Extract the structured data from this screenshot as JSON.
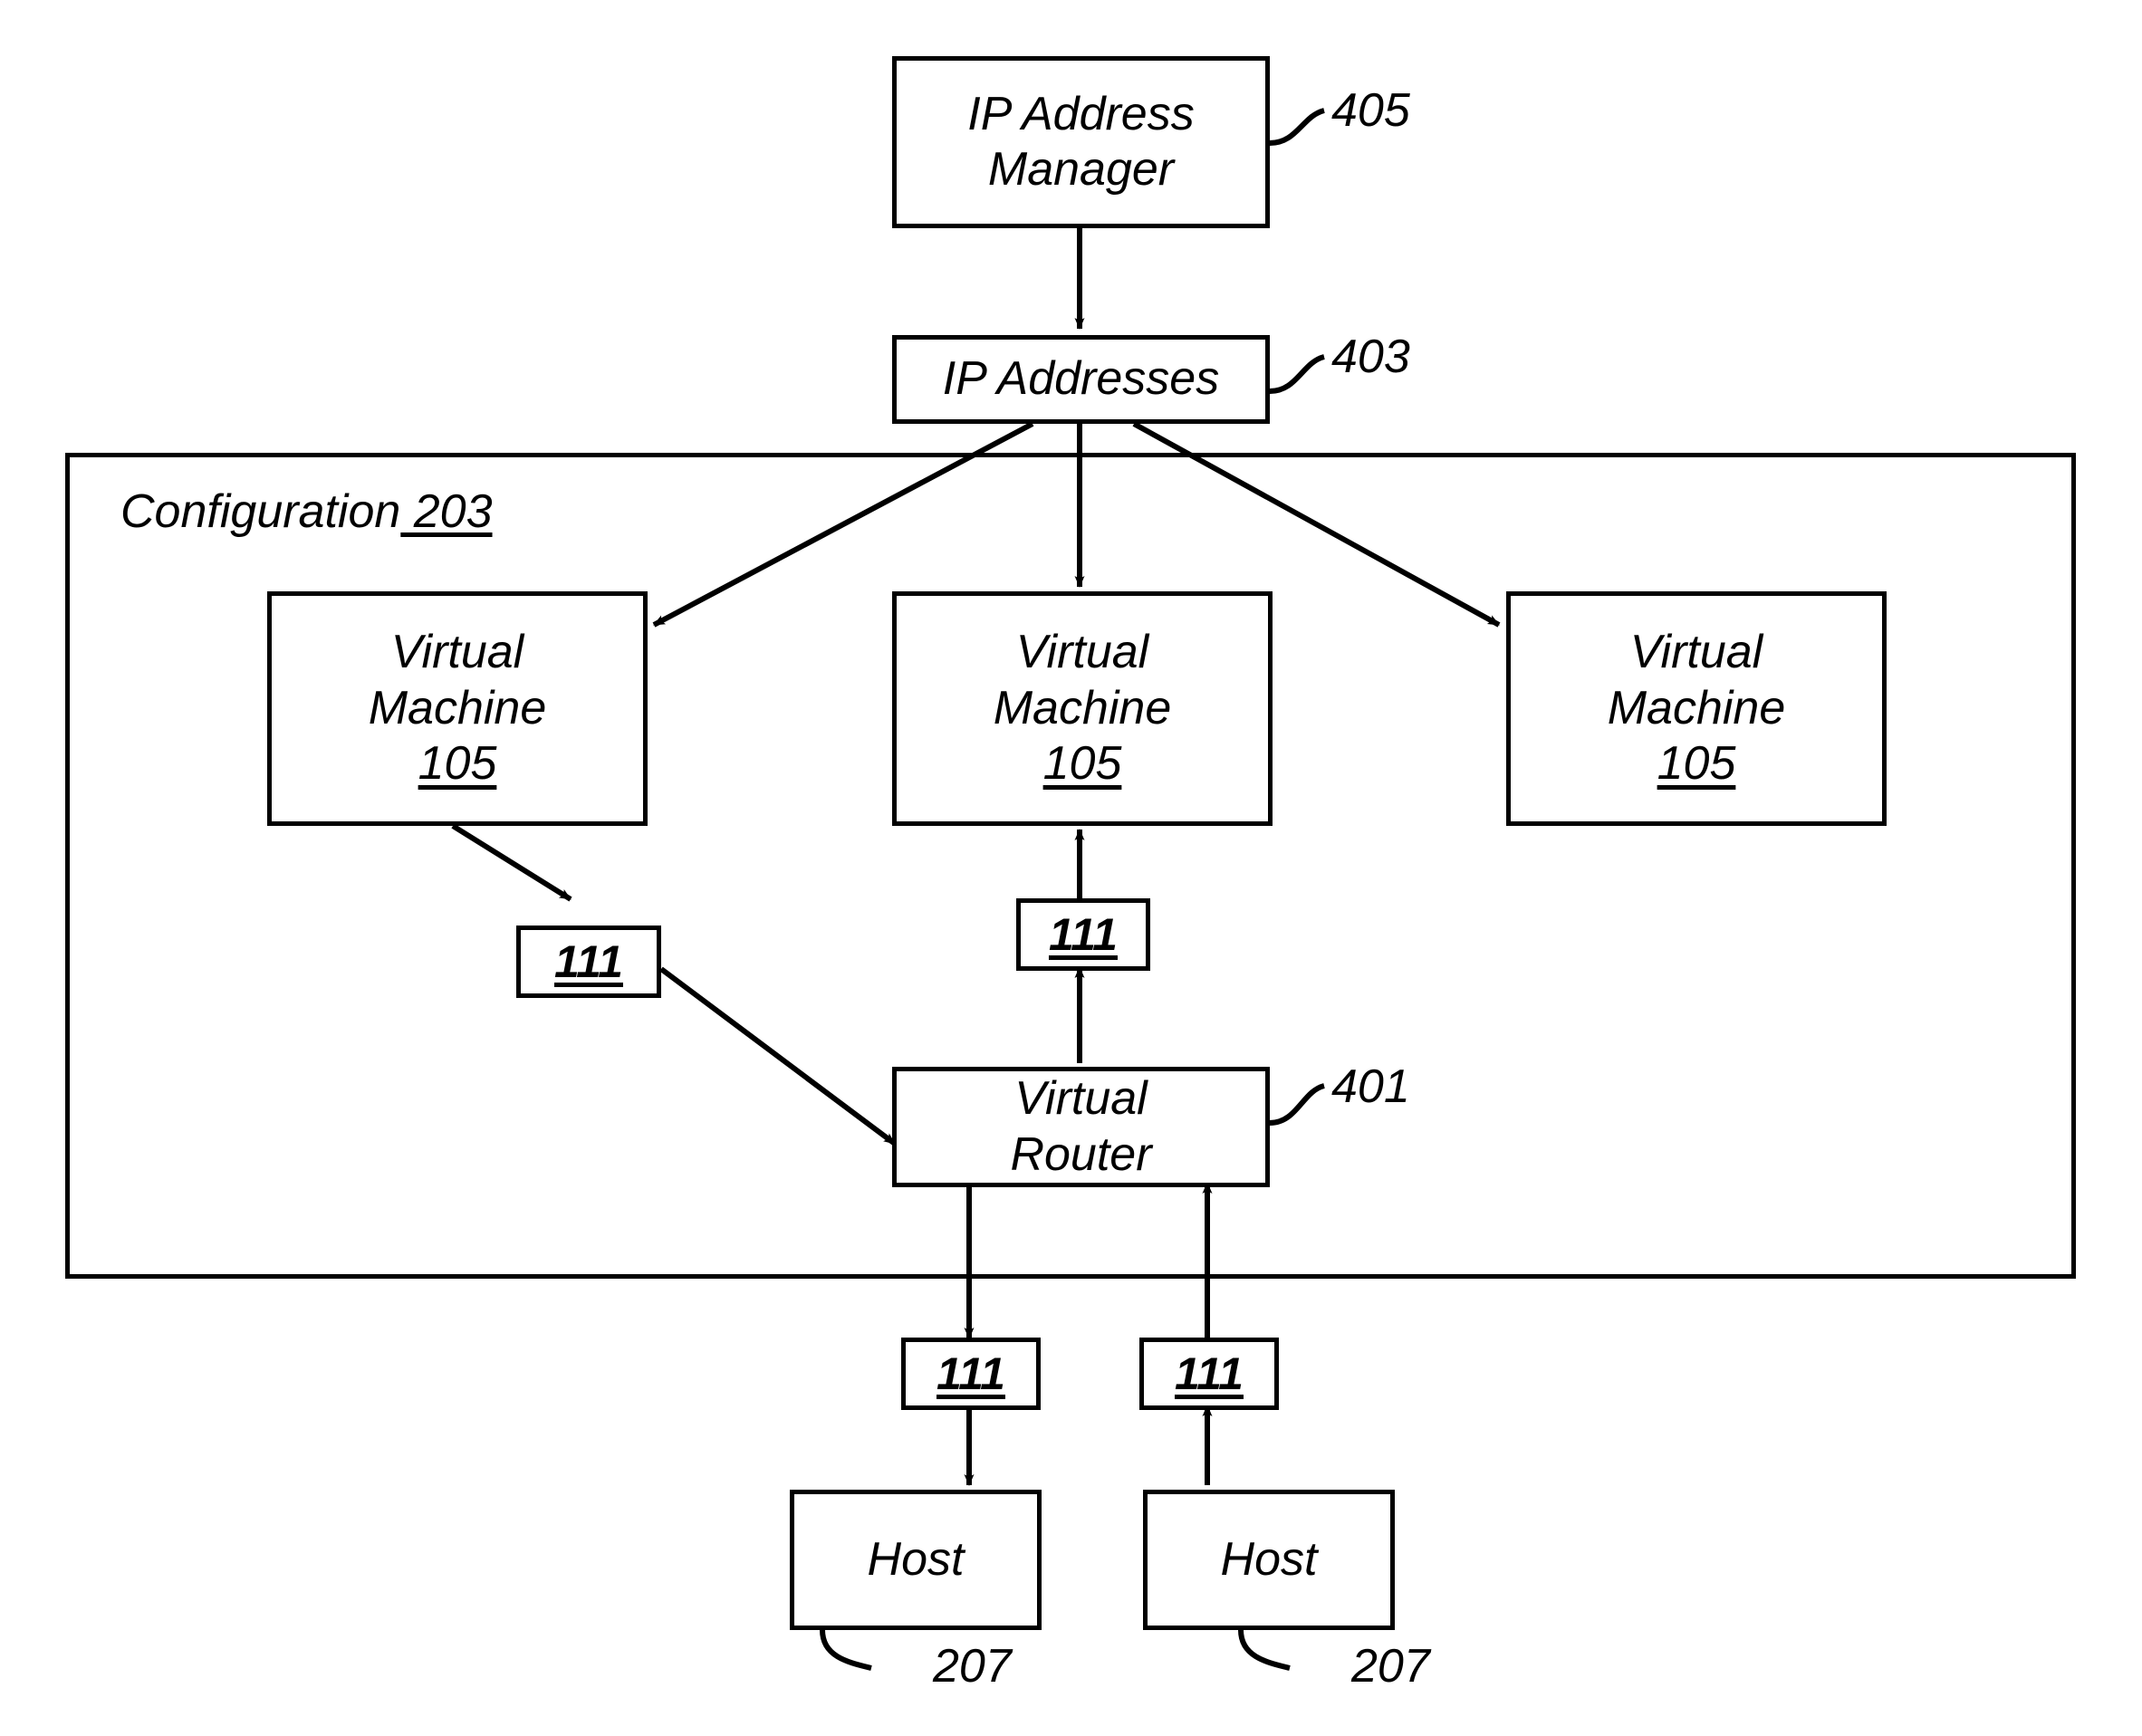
{
  "figure": {
    "title": "Virtual network IP address assignment diagram",
    "background_color": "#ffffff",
    "line_color": "#000000"
  },
  "nodes": {
    "ip_address_manager": {
      "label_line1": "IP Address",
      "label_line2": "Manager",
      "ref": "405"
    },
    "ip_addresses": {
      "label_line1": "IP Addresses",
      "ref": "403"
    },
    "virtual_machine_left": {
      "label_line1": "Virtual",
      "label_line2": "Machine",
      "id": "105"
    },
    "virtual_machine_center": {
      "label_line1": "Virtual",
      "label_line2": "Machine",
      "id": "105"
    },
    "virtual_machine_right": {
      "label_line1": "Virtual",
      "label_line2": "Machine",
      "id": "105"
    },
    "virtual_router": {
      "label_line1": "Virtual",
      "label_line2": "Router",
      "ref": "401"
    },
    "host_left": {
      "label_line1": "Host",
      "ref": "207"
    },
    "host_right": {
      "label_line1": "Host",
      "ref": "207"
    }
  },
  "ports": {
    "vm_left_port": {
      "id": "111"
    },
    "vm_center_port": {
      "id": "111"
    },
    "router_host_left_port": {
      "id": "111"
    },
    "router_host_right_port": {
      "id": "111"
    }
  },
  "group": {
    "label_text": "Configuration",
    "label_num": "203"
  }
}
